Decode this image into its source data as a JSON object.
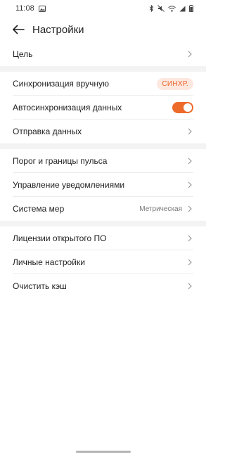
{
  "status_bar": {
    "time": "11:08",
    "left_icon": "image-icon",
    "right_icons": [
      "bluetooth-icon",
      "mute-icon",
      "wifi-icon",
      "signal-icon",
      "battery-icon"
    ]
  },
  "header": {
    "title": "Настройки",
    "back_icon": "arrow-left-icon"
  },
  "settings": {
    "goal": {
      "label": "Цель"
    },
    "manual_sync": {
      "label": "Синхронизация вручную",
      "button": "СИНХР."
    },
    "auto_sync": {
      "label": "Автосинхронизация данных",
      "enabled": true
    },
    "send_data": {
      "label": "Отправка данных"
    },
    "heart_rate": {
      "label": "Порог и границы пульса"
    },
    "notifications": {
      "label": "Управление уведомлениями"
    },
    "units": {
      "label": "Система мер",
      "value": "Метрическая"
    },
    "licenses": {
      "label": "Лицензии открытого ПО"
    },
    "personal": {
      "label": "Личные настройки"
    },
    "clear_cache": {
      "label": "Очистить кэш"
    }
  },
  "colors": {
    "accent": "#ee6a2a",
    "chip_bg": "#fde8df",
    "divider": "#ececec",
    "section_gap": "#f3f3f3"
  }
}
